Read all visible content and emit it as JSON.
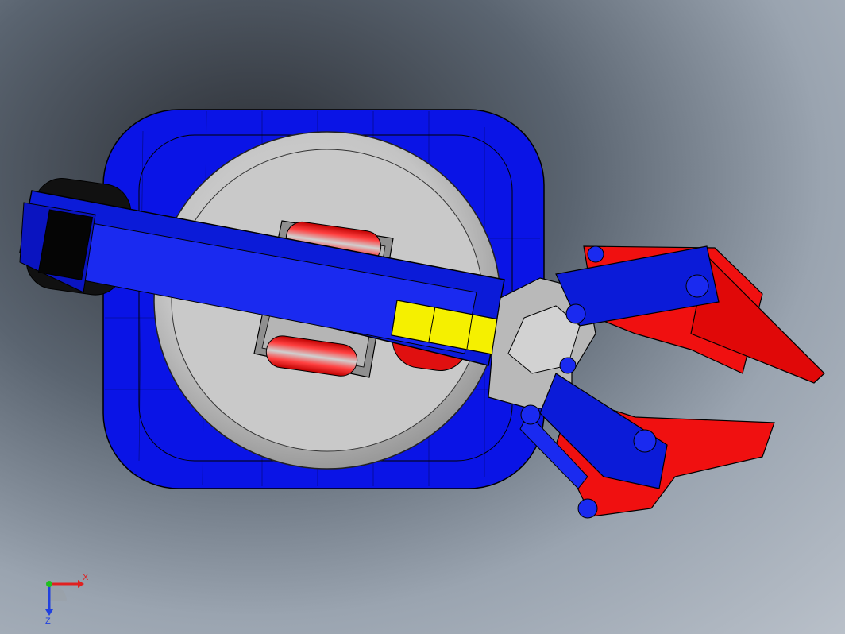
{
  "viewport": {
    "background_top": "#2a2d33",
    "background_bottom": "#b9c0c9"
  },
  "model": {
    "colors": {
      "base": "#0a14e6",
      "turntable": "#c8c8c8",
      "arm": "#0b1bd8",
      "wrist_block": "#f5f000",
      "gripper_hub": "#b9b9b9",
      "finger": "#f01010",
      "wheel": "#111111"
    }
  },
  "triad": {
    "x_label": "X",
    "z_label": "Z",
    "x_color": "#e02020",
    "y_color": "#20c020",
    "z_color": "#2040e0"
  }
}
